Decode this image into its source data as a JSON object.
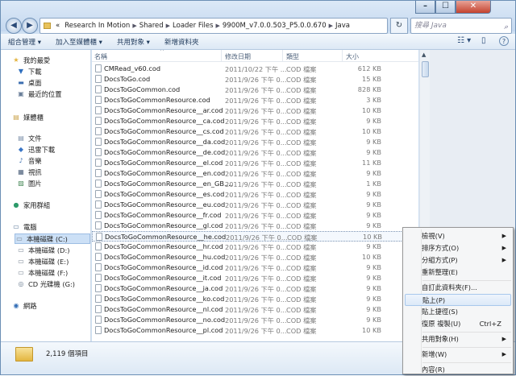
{
  "window": {
    "min": "–",
    "max": "☐",
    "close": "✕"
  },
  "nav_buttons": {
    "back": "◀",
    "forward": "▶"
  },
  "address": {
    "crumbs": [
      "«",
      "Research In Motion",
      "Shared",
      "Loader Files",
      "9900M_v7.0.0.503_P5.0.0.670",
      "Java"
    ],
    "refresh": "↻"
  },
  "search": {
    "placeholder": "搜尋 Java",
    "icon": "search-icon"
  },
  "toolbar": {
    "organize": "組合管理 ▾",
    "add_library": "加入至媒體櫃 ▾",
    "share": "共用對象 ▾",
    "new_folder": "新增資料夾",
    "views": "☷ ▾",
    "preview": "▯",
    "help": "?"
  },
  "sidebar": {
    "items": [
      {
        "label": "我的最愛",
        "icon": "star-icon",
        "glyph": "★",
        "color": "#e3b23c"
      },
      {
        "label": "下載",
        "icon": "download-folder-icon",
        "glyph": "▼",
        "color": "#2f6fbf"
      },
      {
        "label": "桌面",
        "icon": "desktop-icon",
        "glyph": "▬",
        "color": "#3b6db0"
      },
      {
        "label": "最近的位置",
        "icon": "recent-places-icon",
        "glyph": "▣",
        "color": "#6a7f99"
      },
      {
        "label": "媒體櫃",
        "icon": "libraries-icon",
        "glyph": "▤",
        "color": "#c9a24a"
      },
      {
        "label": "文件",
        "icon": "documents-icon",
        "glyph": "▤",
        "color": "#7a8ea8"
      },
      {
        "label": "迅雷下載",
        "icon": "thunder-download-icon",
        "glyph": "◆",
        "color": "#3975c6"
      },
      {
        "label": "音樂",
        "icon": "music-icon",
        "glyph": "♪",
        "color": "#3d6fb0"
      },
      {
        "label": "視訊",
        "icon": "video-icon",
        "glyph": "▦",
        "color": "#4b5f7a"
      },
      {
        "label": "圖片",
        "icon": "pictures-icon",
        "glyph": "▨",
        "color": "#4a8a5a"
      },
      {
        "label": "家用群組",
        "icon": "homegroup-icon",
        "glyph": "●",
        "color": "#2d9a6a"
      },
      {
        "label": "電腦",
        "icon": "computer-icon",
        "glyph": "▭",
        "color": "#5b7898"
      },
      {
        "label": "本機磁碟 (C:)",
        "icon": "drive-c-icon",
        "glyph": "▭",
        "color": "#7b8796"
      },
      {
        "label": "本機磁碟 (D:)",
        "icon": "drive-d-icon",
        "glyph": "▭",
        "color": "#7b8796"
      },
      {
        "label": "本機磁碟 (E:)",
        "icon": "drive-e-icon",
        "glyph": "▭",
        "color": "#7b8796"
      },
      {
        "label": "本機磁碟 (F:)",
        "icon": "drive-f-icon",
        "glyph": "▭",
        "color": "#7b8796"
      },
      {
        "label": "CD 光碟機 (G:)",
        "icon": "cd-drive-icon",
        "glyph": "◎",
        "color": "#6d7f93"
      },
      {
        "label": "網路",
        "icon": "network-icon",
        "glyph": "◉",
        "color": "#2f6bb4"
      }
    ]
  },
  "columns": {
    "name": "名稱",
    "date": "修改日期",
    "type": "類型",
    "size": "大小",
    "sort_arrow": "^"
  },
  "files": [
    {
      "name": "CMRead_v60.cod",
      "date": "2011/10/22 下午 ...",
      "type": "COD 檔案",
      "size": "612 KB"
    },
    {
      "name": "DocsToGo.cod",
      "date": "2011/9/26 下午 0...",
      "type": "COD 檔案",
      "size": "15 KB"
    },
    {
      "name": "DocsToGoCommon.cod",
      "date": "2011/9/26 下午 0...",
      "type": "COD 檔案",
      "size": "828 KB"
    },
    {
      "name": "DocsToGoCommonResource.cod",
      "date": "2011/9/26 下午 0...",
      "type": "COD 檔案",
      "size": "3 KB"
    },
    {
      "name": "DocsToGoCommonResource__ar.cod",
      "date": "2011/9/26 下午 0...",
      "type": "COD 檔案",
      "size": "10 KB"
    },
    {
      "name": "DocsToGoCommonResource__ca.cod",
      "date": "2011/9/26 下午 0...",
      "type": "COD 檔案",
      "size": "9 KB"
    },
    {
      "name": "DocsToGoCommonResource__cs.cod",
      "date": "2011/9/26 下午 0...",
      "type": "COD 檔案",
      "size": "10 KB"
    },
    {
      "name": "DocsToGoCommonResource__da.cod",
      "date": "2011/9/26 下午 0...",
      "type": "COD 檔案",
      "size": "9 KB"
    },
    {
      "name": "DocsToGoCommonResource__de.cod",
      "date": "2011/9/26 下午 0...",
      "type": "COD 檔案",
      "size": "9 KB"
    },
    {
      "name": "DocsToGoCommonResource__el.cod",
      "date": "2011/9/26 下午 0...",
      "type": "COD 檔案",
      "size": "11 KB"
    },
    {
      "name": "DocsToGoCommonResource__en.cod",
      "date": "2011/9/26 下午 0...",
      "type": "COD 檔案",
      "size": "9 KB"
    },
    {
      "name": "DocsToGoCommonResource__en_GB....",
      "date": "2011/9/26 下午 0...",
      "type": "COD 檔案",
      "size": "1 KB"
    },
    {
      "name": "DocsToGoCommonResource__es.cod",
      "date": "2011/9/26 下午 0...",
      "type": "COD 檔案",
      "size": "9 KB"
    },
    {
      "name": "DocsToGoCommonResource__eu.cod",
      "date": "2011/9/26 下午 0...",
      "type": "COD 檔案",
      "size": "9 KB"
    },
    {
      "name": "DocsToGoCommonResource__fr.cod",
      "date": "2011/9/26 下午 0...",
      "type": "COD 檔案",
      "size": "9 KB"
    },
    {
      "name": "DocsToGoCommonResource__gl.cod",
      "date": "2011/9/26 下午 0...",
      "type": "COD 檔案",
      "size": "9 KB"
    },
    {
      "name": "DocsToGoCommonResource__he.cod",
      "date": "2011/9/26 下午 0...",
      "type": "COD 檔案",
      "size": "10 KB"
    },
    {
      "name": "DocsToGoCommonResource__hr.cod",
      "date": "2011/9/26 下午 0...",
      "type": "COD 檔案",
      "size": "9 KB"
    },
    {
      "name": "DocsToGoCommonResource__hu.cod",
      "date": "2011/9/26 下午 0...",
      "type": "COD 檔案",
      "size": "10 KB"
    },
    {
      "name": "DocsToGoCommonResource__id.cod",
      "date": "2011/9/26 下午 0...",
      "type": "COD 檔案",
      "size": "9 KB"
    },
    {
      "name": "DocsToGoCommonResource__it.cod",
      "date": "2011/9/26 下午 0...",
      "type": "COD 檔案",
      "size": "9 KB"
    },
    {
      "name": "DocsToGoCommonResource__ja.cod",
      "date": "2011/9/26 下午 0...",
      "type": "COD 檔案",
      "size": "9 KB"
    },
    {
      "name": "DocsToGoCommonResource__ko.cod",
      "date": "2011/9/26 下午 0...",
      "type": "COD 檔案",
      "size": "9 KB"
    },
    {
      "name": "DocsToGoCommonResource__nl.cod",
      "date": "2011/9/26 下午 0...",
      "type": "COD 檔案",
      "size": "9 KB"
    },
    {
      "name": "DocsToGoCommonResource__no.cod",
      "date": "2011/9/26 下午 0...",
      "type": "COD 檔案",
      "size": "9 KB"
    },
    {
      "name": "DocsToGoCommonResource__pl.cod",
      "date": "2011/9/26 下午 0...",
      "type": "COD 檔案",
      "size": "10 KB"
    }
  ],
  "selected_file_index": 16,
  "status": {
    "item_count": "2,119 個項目"
  },
  "context_menu": {
    "items": [
      {
        "label": "檢視(V)",
        "arrow": "▶",
        "shortcut": ""
      },
      {
        "label": "排序方式(O)",
        "arrow": "▶",
        "shortcut": ""
      },
      {
        "label": "分組方式(P)",
        "arrow": "▶",
        "shortcut": ""
      },
      {
        "label": "重新整理(E)",
        "arrow": "",
        "shortcut": ""
      },
      {
        "label": "自訂此資料夾(F)...",
        "arrow": "",
        "shortcut": ""
      },
      {
        "label": "貼上(P)",
        "arrow": "",
        "shortcut": ""
      },
      {
        "label": "貼上捷徑(S)",
        "arrow": "",
        "shortcut": ""
      },
      {
        "label": "復原 複製(U)",
        "arrow": "",
        "shortcut": "Ctrl+Z"
      },
      {
        "label": "共用對象(H)",
        "arrow": "▶",
        "shortcut": ""
      },
      {
        "label": "新增(W)",
        "arrow": "▶",
        "shortcut": ""
      },
      {
        "label": "內容(R)",
        "arrow": "",
        "shortcut": ""
      }
    ],
    "highlighted_index": 5
  }
}
